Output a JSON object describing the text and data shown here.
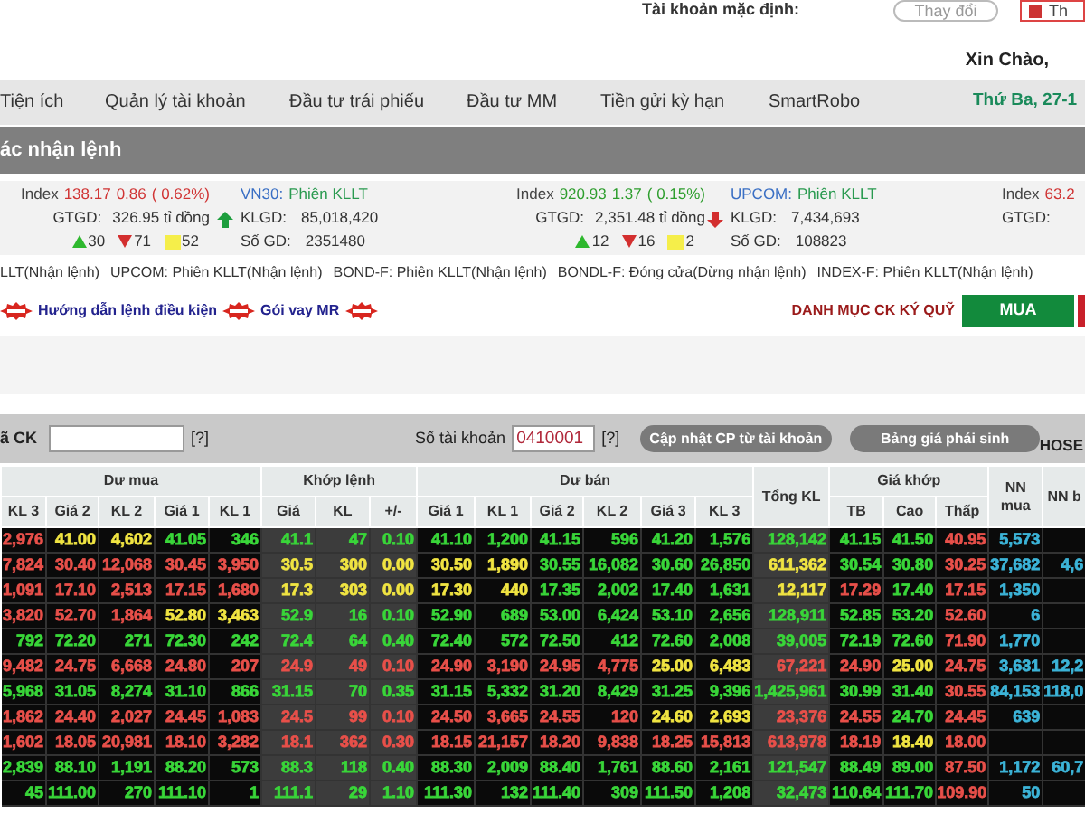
{
  "top_bar": {
    "account_label": "Tài khoản mặc định:",
    "change_button": "Thay đổi",
    "exit_button": "Th"
  },
  "greeting": "Xin Chào,",
  "menu": {
    "items": [
      "Tiện ích",
      "Quản lý tài khoản",
      "Đầu tư trái phiếu",
      "Đầu tư MM",
      "Tiền gửi kỳ hạn",
      "SmartRobo"
    ],
    "date": "Thứ Ba, 27-1"
  },
  "section_title": "ác nhận lệnh",
  "markets": [
    {
      "kind": "index",
      "rising": false,
      "label": "Index",
      "value": "138.17",
      "change": "0.86",
      "percent": "( 0.62%)",
      "gtgd_label": "GTGD:",
      "gtgd": "326.95 tỉ đồng",
      "advances": "30",
      "declines": "71",
      "unchanged": "52"
    },
    {
      "kind": "session",
      "rising": true,
      "name": "VN30:",
      "status": "Phiên KLLT",
      "klgd_label": "KLGD:",
      "klgd": "85,018,420",
      "deals_label": "Số GD:",
      "deals": "2351480"
    },
    {
      "kind": "index",
      "rising": true,
      "label": "Index",
      "value": "920.93",
      "change": "1.37",
      "percent": "( 0.15%)",
      "gtgd_label": "GTGD:",
      "gtgd": "2,351.48 tỉ đồng",
      "advances": "12",
      "declines": "16",
      "unchanged": "2"
    },
    {
      "kind": "session",
      "rising": false,
      "name": "UPCOM:",
      "status": "Phiên KLLT",
      "klgd_label": "KLGD:",
      "klgd": "7,434,693",
      "deals_label": "Số GD:",
      "deals": "108823"
    },
    {
      "kind": "index",
      "rising": false,
      "label": "Index",
      "value": "63.2",
      "gtgd_label": "GTGD:"
    }
  ],
  "sessions": [
    "LLT(Nhận lệnh)",
    "UPCOM: Phiên KLLT(Nhận lệnh)",
    "BOND-F: Phiên KLLT(Nhận lệnh)",
    "BONDL-F: Đóng cửa(Dừng nhận lệnh)",
    "INDEX-F: Phiên KLLT(Nhận lệnh)"
  ],
  "links": [
    {
      "kind": "badge"
    },
    {
      "kind": "link",
      "text": "Hướng dẫn lệnh điều kiện"
    },
    {
      "kind": "badge"
    },
    {
      "kind": "link",
      "text": "Gói vay MR"
    },
    {
      "kind": "badge"
    }
  ],
  "margin_list_link": "DANH MỤC CK KÝ QUỸ",
  "buy_button": "MUA",
  "filter_bar": {
    "symbol_label": "ã CK",
    "symbol_help": "[?]",
    "account_label": "Số tài khoản",
    "account_value": "0410001",
    "account_help": "[?]",
    "update_button": "Cập nhật CP từ tài khoản",
    "derivatives_button": "Bảng giá phái sinh",
    "exchange": "HOSE"
  },
  "table": {
    "groups": [
      {
        "label": "Dư mua",
        "columns": [
          "KL 3",
          "Giá 2",
          "KL 2",
          "Giá 1",
          "KL 1"
        ]
      },
      {
        "label": "Khớp lệnh",
        "columns": [
          "Giá",
          "KL",
          "+/-"
        ]
      },
      {
        "label": "Dư bán",
        "columns": [
          "Giá 1",
          "KL 1",
          "Giá 2",
          "KL 2",
          "Giá 3",
          "KL 3"
        ]
      },
      {
        "label": "Tổng KL"
      },
      {
        "label": "Giá khớp",
        "columns": [
          "TB",
          "Cao",
          "Thấp"
        ]
      },
      {
        "label": "NN mua"
      },
      {
        "label": "NN b"
      }
    ],
    "rows": [
      {
        "cells": [
          {
            "text": "2,976",
            "kind": "down"
          },
          {
            "text": "41.00",
            "kind": "ref"
          },
          {
            "text": "4,602",
            "kind": "ref"
          },
          {
            "text": "41.05",
            "kind": "up"
          },
          {
            "text": "346",
            "kind": "up"
          },
          {
            "text": "41.1",
            "kind": "up"
          },
          {
            "text": "47",
            "kind": "up"
          },
          {
            "text": "0.10",
            "kind": "up"
          },
          {
            "text": "41.10",
            "kind": "up"
          },
          {
            "text": "1,200",
            "kind": "up"
          },
          {
            "text": "41.15",
            "kind": "up"
          },
          {
            "text": "596",
            "kind": "up"
          },
          {
            "text": "41.20",
            "kind": "up"
          },
          {
            "text": "1,576",
            "kind": "up"
          },
          {
            "text": "128,142",
            "kind": "up"
          },
          {
            "text": "41.15",
            "kind": "up"
          },
          {
            "text": "41.50",
            "kind": "up"
          },
          {
            "text": "40.95",
            "kind": "down"
          },
          {
            "text": "5,573",
            "kind": "foreign"
          }
        ]
      },
      {
        "cells": [
          {
            "text": "7,824",
            "kind": "down"
          },
          {
            "text": "30.40",
            "kind": "down"
          },
          {
            "text": "12,068",
            "kind": "down"
          },
          {
            "text": "30.45",
            "kind": "down"
          },
          {
            "text": "3,950",
            "kind": "down"
          },
          {
            "text": "30.5",
            "kind": "ref"
          },
          {
            "text": "300",
            "kind": "ref"
          },
          {
            "text": "0.00",
            "kind": "ref"
          },
          {
            "text": "30.50",
            "kind": "ref"
          },
          {
            "text": "1,890",
            "kind": "ref"
          },
          {
            "text": "30.55",
            "kind": "up"
          },
          {
            "text": "16,082",
            "kind": "up"
          },
          {
            "text": "30.60",
            "kind": "up"
          },
          {
            "text": "26,850",
            "kind": "up"
          },
          {
            "text": "611,362",
            "kind": "ref"
          },
          {
            "text": "30.54",
            "kind": "up"
          },
          {
            "text": "30.80",
            "kind": "up"
          },
          {
            "text": "30.25",
            "kind": "down"
          },
          {
            "text": "37,682",
            "kind": "foreign"
          },
          {
            "text": "4,6",
            "kind": "foreign"
          }
        ]
      },
      {
        "cells": [
          {
            "text": "1,091",
            "kind": "down"
          },
          {
            "text": "17.10",
            "kind": "down"
          },
          {
            "text": "2,513",
            "kind": "down"
          },
          {
            "text": "17.15",
            "kind": "down"
          },
          {
            "text": "1,680",
            "kind": "down"
          },
          {
            "text": "17.3",
            "kind": "ref"
          },
          {
            "text": "303",
            "kind": "ref"
          },
          {
            "text": "0.00",
            "kind": "ref"
          },
          {
            "text": "17.30",
            "kind": "ref"
          },
          {
            "text": "440",
            "kind": "ref"
          },
          {
            "text": "17.35",
            "kind": "up"
          },
          {
            "text": "2,002",
            "kind": "up"
          },
          {
            "text": "17.40",
            "kind": "up"
          },
          {
            "text": "1,631",
            "kind": "up"
          },
          {
            "text": "12,117",
            "kind": "ref"
          },
          {
            "text": "17.29",
            "kind": "down"
          },
          {
            "text": "17.40",
            "kind": "up"
          },
          {
            "text": "17.15",
            "kind": "down"
          },
          {
            "text": "1,350",
            "kind": "foreign"
          }
        ]
      },
      {
        "cells": [
          {
            "text": "3,820",
            "kind": "down"
          },
          {
            "text": "52.70",
            "kind": "down"
          },
          {
            "text": "1,864",
            "kind": "down"
          },
          {
            "text": "52.80",
            "kind": "ref"
          },
          {
            "text": "3,463",
            "kind": "ref"
          },
          {
            "text": "52.9",
            "kind": "up"
          },
          {
            "text": "16",
            "kind": "up"
          },
          {
            "text": "0.10",
            "kind": "up"
          },
          {
            "text": "52.90",
            "kind": "up"
          },
          {
            "text": "689",
            "kind": "up"
          },
          {
            "text": "53.00",
            "kind": "up"
          },
          {
            "text": "6,424",
            "kind": "up"
          },
          {
            "text": "53.10",
            "kind": "up"
          },
          {
            "text": "2,656",
            "kind": "up"
          },
          {
            "text": "128,911",
            "kind": "up"
          },
          {
            "text": "52.85",
            "kind": "up"
          },
          {
            "text": "53.20",
            "kind": "up"
          },
          {
            "text": "52.60",
            "kind": "down"
          },
          {
            "text": "6",
            "kind": "foreign"
          }
        ]
      },
      {
        "cells": [
          {
            "text": "792",
            "kind": "up"
          },
          {
            "text": "72.20",
            "kind": "up"
          },
          {
            "text": "271",
            "kind": "up"
          },
          {
            "text": "72.30",
            "kind": "up"
          },
          {
            "text": "242",
            "kind": "up"
          },
          {
            "text": "72.4",
            "kind": "up"
          },
          {
            "text": "64",
            "kind": "up"
          },
          {
            "text": "0.40",
            "kind": "up"
          },
          {
            "text": "72.40",
            "kind": "up"
          },
          {
            "text": "572",
            "kind": "up"
          },
          {
            "text": "72.50",
            "kind": "up"
          },
          {
            "text": "412",
            "kind": "up"
          },
          {
            "text": "72.60",
            "kind": "up"
          },
          {
            "text": "2,008",
            "kind": "up"
          },
          {
            "text": "39,005",
            "kind": "up"
          },
          {
            "text": "72.19",
            "kind": "up"
          },
          {
            "text": "72.60",
            "kind": "up"
          },
          {
            "text": "71.90",
            "kind": "down"
          },
          {
            "text": "1,770",
            "kind": "foreign"
          }
        ]
      },
      {
        "cells": [
          {
            "text": "9,482",
            "kind": "down"
          },
          {
            "text": "24.75",
            "kind": "down"
          },
          {
            "text": "6,668",
            "kind": "down"
          },
          {
            "text": "24.80",
            "kind": "down"
          },
          {
            "text": "207",
            "kind": "down"
          },
          {
            "text": "24.9",
            "kind": "down"
          },
          {
            "text": "49",
            "kind": "down"
          },
          {
            "text": "0.10",
            "kind": "down"
          },
          {
            "text": "24.90",
            "kind": "down"
          },
          {
            "text": "3,190",
            "kind": "down"
          },
          {
            "text": "24.95",
            "kind": "down"
          },
          {
            "text": "4,775",
            "kind": "down"
          },
          {
            "text": "25.00",
            "kind": "ref"
          },
          {
            "text": "6,483",
            "kind": "ref"
          },
          {
            "text": "67,221",
            "kind": "down"
          },
          {
            "text": "24.90",
            "kind": "down"
          },
          {
            "text": "25.00",
            "kind": "ref"
          },
          {
            "text": "24.75",
            "kind": "down"
          },
          {
            "text": "3,631",
            "kind": "foreign"
          },
          {
            "text": "12,2",
            "kind": "foreign"
          }
        ]
      },
      {
        "cells": [
          {
            "text": "5,968",
            "kind": "up"
          },
          {
            "text": "31.05",
            "kind": "up"
          },
          {
            "text": "8,274",
            "kind": "up"
          },
          {
            "text": "31.10",
            "kind": "up"
          },
          {
            "text": "866",
            "kind": "up"
          },
          {
            "text": "31.15",
            "kind": "up"
          },
          {
            "text": "70",
            "kind": "up"
          },
          {
            "text": "0.35",
            "kind": "up"
          },
          {
            "text": "31.15",
            "kind": "up"
          },
          {
            "text": "5,332",
            "kind": "up"
          },
          {
            "text": "31.20",
            "kind": "up"
          },
          {
            "text": "8,429",
            "kind": "up"
          },
          {
            "text": "31.25",
            "kind": "up"
          },
          {
            "text": "9,396",
            "kind": "up"
          },
          {
            "text": "1,425,961",
            "kind": "up"
          },
          {
            "text": "30.99",
            "kind": "up"
          },
          {
            "text": "31.40",
            "kind": "up"
          },
          {
            "text": "30.55",
            "kind": "down"
          },
          {
            "text": "84,153",
            "kind": "foreign"
          },
          {
            "text": "118,0",
            "kind": "foreign"
          }
        ]
      },
      {
        "cells": [
          {
            "text": "1,862",
            "kind": "down"
          },
          {
            "text": "24.40",
            "kind": "down"
          },
          {
            "text": "2,027",
            "kind": "down"
          },
          {
            "text": "24.45",
            "kind": "down"
          },
          {
            "text": "1,083",
            "kind": "down"
          },
          {
            "text": "24.5",
            "kind": "down"
          },
          {
            "text": "99",
            "kind": "down"
          },
          {
            "text": "0.10",
            "kind": "down"
          },
          {
            "text": "24.50",
            "kind": "down"
          },
          {
            "text": "3,665",
            "kind": "down"
          },
          {
            "text": "24.55",
            "kind": "down"
          },
          {
            "text": "120",
            "kind": "down"
          },
          {
            "text": "24.60",
            "kind": "ref"
          },
          {
            "text": "2,693",
            "kind": "ref"
          },
          {
            "text": "23,376",
            "kind": "down"
          },
          {
            "text": "24.55",
            "kind": "down"
          },
          {
            "text": "24.70",
            "kind": "up"
          },
          {
            "text": "24.45",
            "kind": "down"
          },
          {
            "text": "639",
            "kind": "foreign"
          }
        ]
      },
      {
        "cells": [
          {
            "text": "1,602",
            "kind": "down"
          },
          {
            "text": "18.05",
            "kind": "down"
          },
          {
            "text": "20,981",
            "kind": "down"
          },
          {
            "text": "18.10",
            "kind": "down"
          },
          {
            "text": "3,282",
            "kind": "down"
          },
          {
            "text": "18.1",
            "kind": "down"
          },
          {
            "text": "362",
            "kind": "down"
          },
          {
            "text": "0.30",
            "kind": "down"
          },
          {
            "text": "18.15",
            "kind": "down"
          },
          {
            "text": "21,157",
            "kind": "down"
          },
          {
            "text": "18.20",
            "kind": "down"
          },
          {
            "text": "9,838",
            "kind": "down"
          },
          {
            "text": "18.25",
            "kind": "down"
          },
          {
            "text": "15,813",
            "kind": "down"
          },
          {
            "text": "613,978",
            "kind": "down"
          },
          {
            "text": "18.19",
            "kind": "down"
          },
          {
            "text": "18.40",
            "kind": "ref"
          },
          {
            "text": "18.00",
            "kind": "down"
          }
        ]
      },
      {
        "cells": [
          {
            "text": "2,839",
            "kind": "up"
          },
          {
            "text": "88.10",
            "kind": "up"
          },
          {
            "text": "1,191",
            "kind": "up"
          },
          {
            "text": "88.20",
            "kind": "up"
          },
          {
            "text": "573",
            "kind": "up"
          },
          {
            "text": "88.3",
            "kind": "up"
          },
          {
            "text": "118",
            "kind": "up"
          },
          {
            "text": "0.40",
            "kind": "up"
          },
          {
            "text": "88.30",
            "kind": "up"
          },
          {
            "text": "2,009",
            "kind": "up"
          },
          {
            "text": "88.40",
            "kind": "up"
          },
          {
            "text": "1,761",
            "kind": "up"
          },
          {
            "text": "88.60",
            "kind": "up"
          },
          {
            "text": "2,161",
            "kind": "up"
          },
          {
            "text": "121,547",
            "kind": "up"
          },
          {
            "text": "88.49",
            "kind": "up"
          },
          {
            "text": "89.00",
            "kind": "up"
          },
          {
            "text": "87.50",
            "kind": "down"
          },
          {
            "text": "1,172",
            "kind": "foreign"
          },
          {
            "text": "60,7",
            "kind": "foreign"
          }
        ]
      },
      {
        "cells": [
          {
            "text": "45",
            "kind": "up"
          },
          {
            "text": "111.00",
            "kind": "up"
          },
          {
            "text": "270",
            "kind": "up"
          },
          {
            "text": "111.10",
            "kind": "up"
          },
          {
            "text": "1",
            "kind": "up"
          },
          {
            "text": "111.1",
            "kind": "up"
          },
          {
            "text": "29",
            "kind": "up"
          },
          {
            "text": "1.10",
            "kind": "up"
          },
          {
            "text": "111.30",
            "kind": "up"
          },
          {
            "text": "132",
            "kind": "up"
          },
          {
            "text": "111.40",
            "kind": "up"
          },
          {
            "text": "309",
            "kind": "up"
          },
          {
            "text": "111.50",
            "kind": "up"
          },
          {
            "text": "1,208",
            "kind": "up"
          },
          {
            "text": "32,473",
            "kind": "up"
          },
          {
            "text": "110.64",
            "kind": "up"
          },
          {
            "text": "111.70",
            "kind": "up"
          },
          {
            "text": "109.90",
            "kind": "down"
          },
          {
            "text": "50",
            "kind": "foreign"
          }
        ]
      }
    ]
  }
}
